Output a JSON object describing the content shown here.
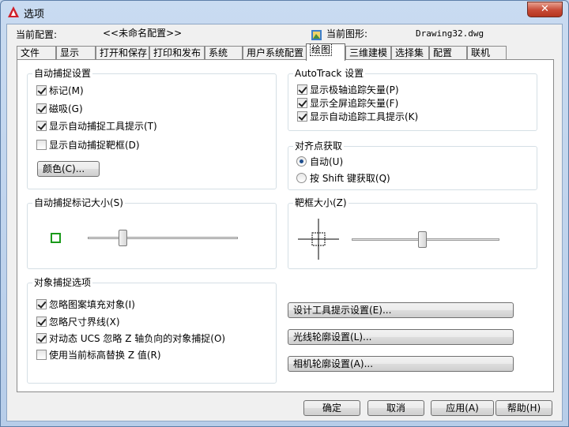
{
  "window": {
    "title": "选项",
    "close_glyph": "✕"
  },
  "header": {
    "profile_label": "当前配置:",
    "profile_value": "<<未命名配置>>",
    "drawing_label": "当前图形:",
    "drawing_value": "Drawing32.dwg"
  },
  "tabs": [
    "文件",
    "显示",
    "打开和保存",
    "打印和发布",
    "系统",
    "用户系统配置",
    "绘图",
    "三维建模",
    "选择集",
    "配置",
    "联机"
  ],
  "active_tab": "绘图",
  "autosnap": {
    "title": "自动捕捉设置",
    "options": [
      {
        "label": "标记(M)",
        "checked": true
      },
      {
        "label": "磁吸(G)",
        "checked": true
      },
      {
        "label": "显示自动捕捉工具提示(T)",
        "checked": true
      },
      {
        "label": "显示自动捕捉靶框(D)",
        "checked": false
      }
    ],
    "color_button": "颜色(C)..."
  },
  "autotrack": {
    "title": "AutoTrack 设置",
    "options": [
      {
        "label": "显示极轴追踪矢量(P)",
        "checked": true
      },
      {
        "label": "显示全屏追踪矢量(F)",
        "checked": true
      },
      {
        "label": "显示自动追踪工具提示(K)",
        "checked": true
      }
    ]
  },
  "alignment": {
    "title": "对齐点获取",
    "options": [
      {
        "label": "自动(U)",
        "selected": true
      },
      {
        "label": "按 Shift 键获取(Q)",
        "selected": false
      }
    ]
  },
  "marker_size": {
    "title": "自动捕捉标记大小(S)",
    "level": 0.22
  },
  "aperture_size": {
    "title": "靶框大小(Z)",
    "level": 0.48
  },
  "osnap": {
    "title": "对象捕捉选项",
    "options": [
      {
        "label": "忽略图案填充对象(I)",
        "checked": true
      },
      {
        "label": "忽略尺寸界线(X)",
        "checked": true
      },
      {
        "label": "对动态 UCS 忽略 Z 轴负向的对象捕捉(O)",
        "checked": true
      },
      {
        "label": "使用当前标高替换 Z 值(R)",
        "checked": false
      }
    ]
  },
  "side_buttons": [
    "设计工具提示设置(E)...",
    "光线轮廓设置(L)...",
    "相机轮廓设置(A)..."
  ],
  "footer": {
    "ok": "确定",
    "cancel": "取消",
    "apply": "应用(A)",
    "help": "帮助(H)"
  },
  "colors": {
    "marker": "#1a9a1a",
    "close": "#c74a36",
    "title_bg": "#c9dbf1"
  }
}
